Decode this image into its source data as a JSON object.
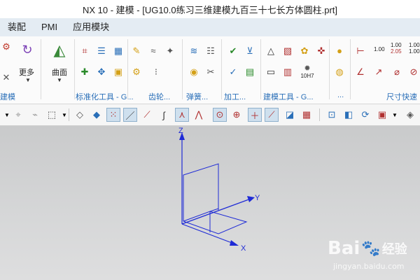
{
  "window": {
    "title": "NX 10 - 建模 - [UG10.0练习三维建模九百三十七长方体圆柱.prt]"
  },
  "menubar": {
    "items": [
      "装配",
      "PMI",
      "应用模块"
    ]
  },
  "ribbon": {
    "left_group_label": "建模",
    "more_label": "更多",
    "surface_label": "曲面",
    "groups": [
      {
        "label": "标准化工具 - G..."
      },
      {
        "label": "齿轮..."
      },
      {
        "label": "弹簧..."
      },
      {
        "label": "加工..."
      },
      {
        "label": "建模工具 - G..."
      },
      {
        "label": "..."
      },
      {
        "label": "尺寸快速"
      }
    ],
    "dim_texts": {
      "d1": "1.00",
      "d2_top": "1.00",
      "d2_bottom": "2.05",
      "d3_top": "1.00",
      "d3_bottom": "1.00",
      "fit": "10H7"
    }
  },
  "viewport": {
    "axes": {
      "x": "X",
      "y": "Y",
      "z": "Z"
    },
    "watermark": {
      "brand_left": "Bai",
      "brand_right": "经验",
      "url": "jingyan.baidu.com"
    }
  },
  "colors": {
    "model_lines": "#1f2bd6",
    "ribbon_link": "#2a6fb8",
    "menubar_bg": "#e4ecf3"
  }
}
